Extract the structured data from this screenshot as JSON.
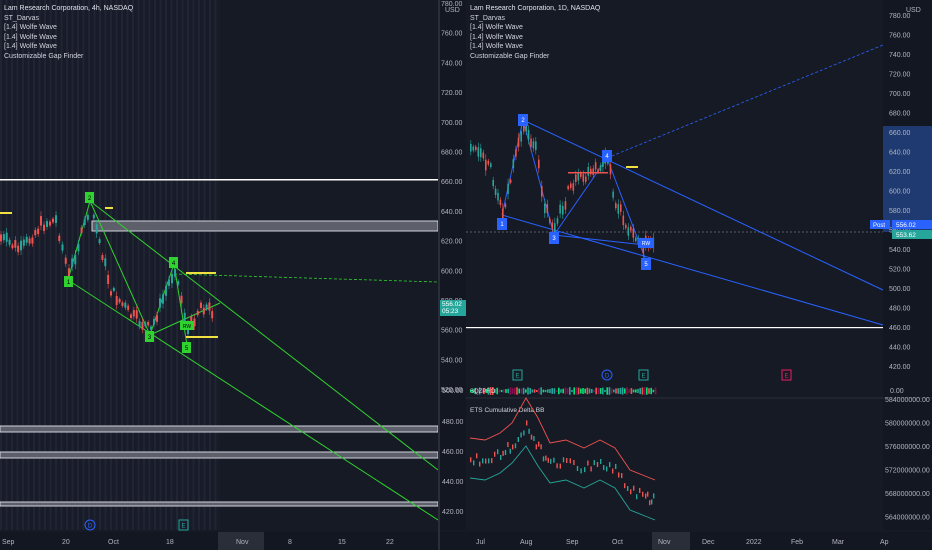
{
  "left_chart": {
    "legend": [
      "Lam Research Corporation, 4h, NASDAQ",
      "ST_Darvas",
      "[1.4] Wolfe Wave",
      "[1.4] Wolfe Wave",
      "[1.4] Wolfe Wave",
      "Customizable Gap Finder"
    ],
    "price_ticks": [
      "640.00",
      "620.00",
      "600.00",
      "580.00",
      "560.00",
      "540.00",
      "520.00",
      "500.00",
      "480.00",
      "460.00",
      "440.00",
      "420.00"
    ],
    "price_label": "556.02",
    "countdown": "05:23",
    "time_labels": [
      "Sep",
      "20",
      "Oct",
      "18",
      "Nov",
      "8",
      "15",
      "22"
    ],
    "wave_labels": [
      "1",
      "2",
      "3",
      "4",
      "5",
      "RW"
    ],
    "event_labels": [
      "D",
      "E"
    ]
  },
  "right_chart": {
    "legend": [
      "Lam Research Corporation, 1D, NASDAQ",
      "ST_Darvas",
      "[1.4] Wolfe Wave",
      "[1.4] Wolfe Wave",
      "[1.4] Wolfe Wave",
      "Customizable Gap Finder"
    ],
    "currency_left": "USD",
    "currency_right": "USD",
    "price_ticks_right": [
      "780.00",
      "760.00",
      "740.00",
      "720.00",
      "700.00",
      "680.00",
      "660.00",
      "640.00",
      "620.00",
      "600.00",
      "580.00",
      "560.00",
      "540.00",
      "520.00",
      "500.00",
      "480.00",
      "460.00",
      "440.00",
      "420.00"
    ],
    "price_ticks_left": [
      "780.00",
      "760.00",
      "740.00",
      "720.00",
      "700.00",
      "680.00",
      "660.00",
      "640.00",
      "620.00",
      "600.00",
      "580.00",
      "560.00",
      "540.00",
      "520.00"
    ],
    "post_tag": "Post",
    "price_label": "556.02",
    "post_price_label": "553.62",
    "wave_labels": [
      "1",
      "2",
      "3",
      "4",
      "5",
      "RW"
    ],
    "event_labels": [
      "E",
      "D",
      "E",
      "E"
    ],
    "time_labels": [
      "Jul",
      "Aug",
      "Sep",
      "Oct",
      "Nov",
      "Dec",
      "2022",
      "Feb",
      "Mar",
      "Ap"
    ],
    "indicator1": {
      "name": "SQZPRO",
      "left_value": "500.00",
      "right_value": "0.00"
    },
    "indicator2": {
      "name": "ETS Cumulative Delta BB",
      "left_ticks": [
        "480.00",
        "460.00",
        "440.00",
        "420.00"
      ],
      "right_ticks": [
        "584000000.00",
        "580000000.00",
        "576000000.00",
        "572000000.00",
        "568000000.00",
        "564000000.00"
      ]
    }
  },
  "colors": {
    "bg": "#161a25",
    "up": "#26a69a",
    "down": "#ef5350",
    "wolfe_green": "#2fd22f",
    "wolfe_blue": "#2962ff",
    "price_tag": "#26a69a"
  }
}
